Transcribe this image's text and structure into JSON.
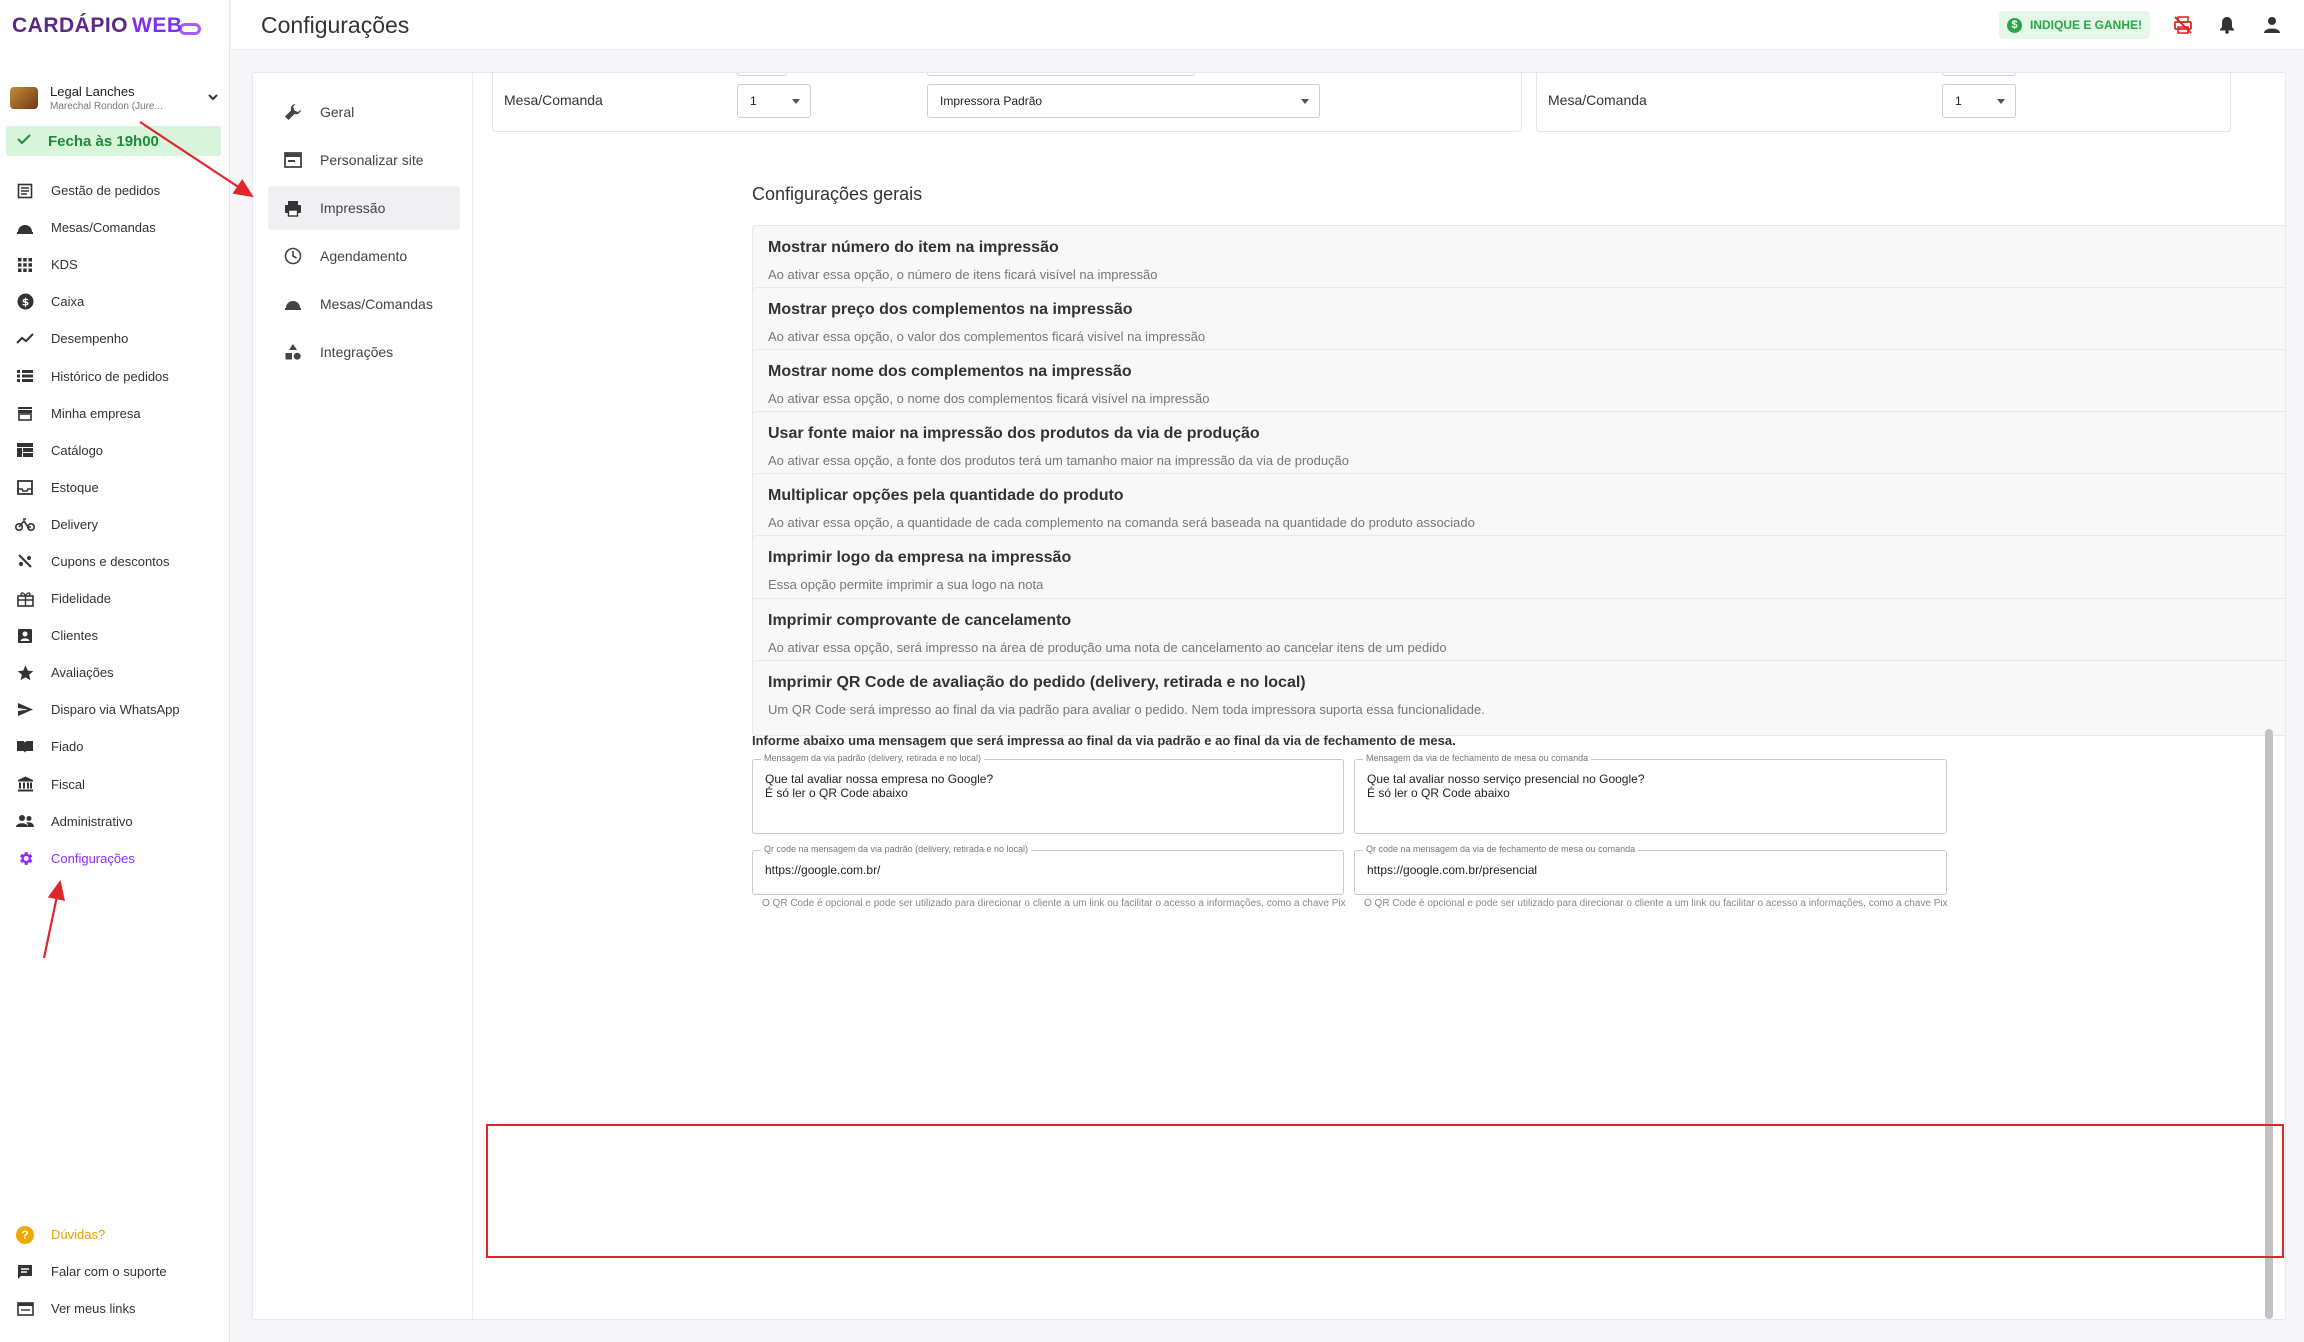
{
  "brand": {
    "logo_main": "CARDÁPIO",
    "logo_accent": "WEB"
  },
  "store": {
    "name": "Legal Lanches",
    "address": "Marechal Rondon (Jure..."
  },
  "status": {
    "closes": "Fecha às 19h00"
  },
  "sidebar": {
    "items": [
      {
        "label": "Gestão de pedidos",
        "icon": "orders-icon"
      },
      {
        "label": "Mesas/Comandas",
        "icon": "cloche-icon"
      },
      {
        "label": "KDS",
        "icon": "grid-icon"
      },
      {
        "label": "Caixa",
        "icon": "dollar-icon"
      },
      {
        "label": "Desempenho",
        "icon": "trending-icon"
      },
      {
        "label": "Histórico de pedidos",
        "icon": "list-icon"
      },
      {
        "label": "Minha empresa",
        "icon": "store-icon"
      },
      {
        "label": "Catálogo",
        "icon": "catalog-icon"
      },
      {
        "label": "Estoque",
        "icon": "inbox-icon"
      },
      {
        "label": "Delivery",
        "icon": "bike-icon"
      },
      {
        "label": "Cupons e descontos",
        "icon": "coupon-icon"
      },
      {
        "label": "Fidelidade",
        "icon": "gift-icon"
      },
      {
        "label": "Clientes",
        "icon": "contact-icon"
      },
      {
        "label": "Avaliações",
        "icon": "star-icon"
      },
      {
        "label": "Disparo via WhatsApp",
        "icon": "send-icon"
      },
      {
        "label": "Fiado",
        "icon": "book-icon"
      },
      {
        "label": "Fiscal",
        "icon": "bank-icon"
      },
      {
        "label": "Administrativo",
        "icon": "people-icon"
      },
      {
        "label": "Configurações",
        "icon": "gear-icon",
        "active": true
      }
    ],
    "bottom": [
      {
        "label": "Dúvidas?",
        "icon": "help-icon"
      },
      {
        "label": "Falar com o suporte",
        "icon": "chat-icon"
      },
      {
        "label": "Ver meus links",
        "icon": "link-icon"
      }
    ]
  },
  "header": {
    "title": "Configurações",
    "referral": "INDIQUE E GANHE!"
  },
  "subnav": {
    "items": [
      {
        "label": "Geral",
        "icon": "wrench-icon"
      },
      {
        "label": "Personalizar site",
        "icon": "browser-icon"
      },
      {
        "label": "Impressão",
        "icon": "printer-icon",
        "active": true
      },
      {
        "label": "Agendamento",
        "icon": "clock-icon"
      },
      {
        "label": "Mesas/Comandas",
        "icon": "cloche-icon"
      },
      {
        "label": "Integrações",
        "icon": "shapes-icon"
      }
    ]
  },
  "printers": {
    "left_label": "Mesa/Comanda",
    "left_copies": "1",
    "left_printer": "Impressora Padrão",
    "right_label": "Mesa/Comanda",
    "right_copies": "1"
  },
  "general": {
    "title": "Configurações gerais",
    "options": [
      {
        "title": "Mostrar número do item na impressão",
        "desc": "Ao ativar essa opção, o número de itens ficará visível na impressão",
        "state": "Ativado",
        "on": true
      },
      {
        "title": "Mostrar preço dos complementos na impressão",
        "desc": "Ao ativar essa opção, o valor dos complementos ficará visível na impressão",
        "state": "Desativado",
        "on": false
      },
      {
        "title": "Mostrar nome dos complementos na impressão",
        "desc": "Ao ativar essa opção, o nome dos complementos ficará visível na impressão",
        "state": "Ativado",
        "on": true
      },
      {
        "title": "Usar fonte maior na impressão dos produtos da via de produção",
        "desc": "Ao ativar essa opção, a fonte dos produtos terá um tamanho maior na impressão da via de produção",
        "state": "Desativado",
        "on": false
      },
      {
        "title": "Multiplicar opções pela quantidade do produto",
        "desc": "Ao ativar essa opção, a quantidade de cada complemento na comanda será baseada na quantidade do produto associado",
        "state": "Desativado",
        "on": false
      },
      {
        "title": "Imprimir logo da empresa na impressão",
        "desc": "Essa opção permite imprimir a sua logo na nota",
        "state": "Ativado",
        "on": true
      },
      {
        "title": "Imprimir comprovante de cancelamento",
        "desc": "Ao ativar essa opção, será impresso na área de produção uma nota de cancelamento ao cancelar itens de um pedido",
        "state": "Desativado",
        "on": false
      },
      {
        "title": "Imprimir QR Code de avaliação do pedido (delivery, retirada e no local)",
        "desc": "Um QR Code será impresso ao final da via padrão para avaliar o pedido. Nem toda impressora suporta essa funcionalidade.",
        "state": "Desativado",
        "on": false
      }
    ]
  },
  "messages": {
    "info": "Informe abaixo uma mensagem que será impressa ao final da via padrão e ao final da via de fechamento de mesa.",
    "default_label": "Mensagem da via padrão (delivery, retirada e no local)",
    "default_value": "Que tal avaliar nossa empresa no Google?\nÉ só ler o QR Code abaixo",
    "closing_label": "Mensagem da via de fechamento de mesa ou comanda",
    "closing_value": "Que tal avaliar nosso serviço presencial no Google?\nÉ só ler o QR Code abaixo",
    "qr_default_label": "Qr code na mensagem da via padrão (delivery, retirada e no local)",
    "qr_default_value": "https://google.com.br/",
    "qr_closing_label": "Qr code na mensagem da via de fechamento de mesa ou comanda",
    "qr_closing_value": "https://google.com.br/presencial",
    "qr_hint": "O QR Code é opcional e pode ser utilizado para direcionar o cliente a um link ou facilitar o acesso a informações, como a chave Pix"
  },
  "colors": {
    "accent": "#8b2cf5",
    "success": "#28a745",
    "annotation": "#e0262a"
  }
}
